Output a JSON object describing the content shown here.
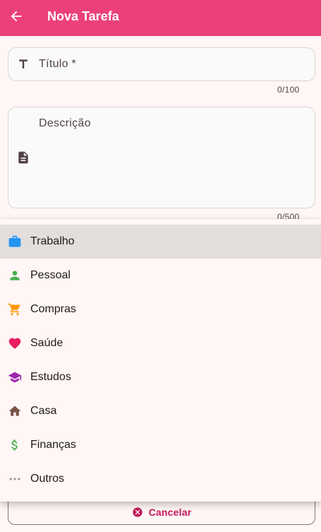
{
  "appbar": {
    "title": "Nova Tarefa",
    "back_icon": "arrow-left-icon",
    "color": "#ec407a"
  },
  "form": {
    "title_field": {
      "label": "Título *",
      "counter": "0/100",
      "icon": "title-text-icon"
    },
    "description_field": {
      "label": "Descrição",
      "counter": "0/500",
      "icon": "document-icon"
    }
  },
  "category_menu": {
    "items": [
      {
        "label": "Trabalho",
        "icon": "briefcase-icon",
        "color": "#2196f3",
        "selected": true
      },
      {
        "label": "Pessoal",
        "icon": "person-icon",
        "color": "#4caf50",
        "selected": false
      },
      {
        "label": "Compras",
        "icon": "shopping-cart-icon",
        "color": "#ff9800",
        "selected": false
      },
      {
        "label": "Saúde",
        "icon": "heart-icon",
        "color": "#e91e63",
        "selected": false
      },
      {
        "label": "Estudos",
        "icon": "graduation-cap-icon",
        "color": "#9c27b0",
        "selected": false
      },
      {
        "label": "Casa",
        "icon": "home-icon",
        "color": "#795548",
        "selected": false
      },
      {
        "label": "Finanças",
        "icon": "dollar-icon",
        "color": "#4caf50",
        "selected": false
      },
      {
        "label": "Outros",
        "icon": "more-horizontal-icon",
        "color": "#9e9e9e",
        "selected": false
      }
    ]
  },
  "actions": {
    "cancel_label": "Cancelar",
    "cancel_icon": "cancel-circle-icon",
    "cancel_color": "#c2185b"
  }
}
